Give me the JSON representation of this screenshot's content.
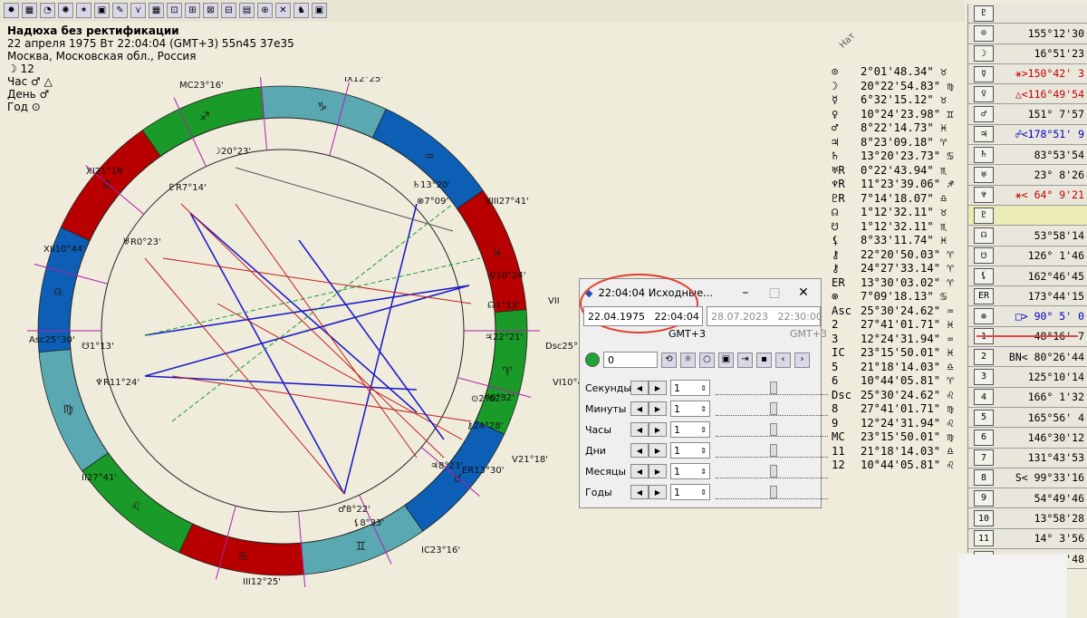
{
  "header": {
    "title": "Надюха без ректификации",
    "date_line": "22 апреля 1975  Вт  22:04:04 (GMT+3) 55n45  37e35",
    "place": "Москва, Московская обл., Россия",
    "moon_line": "☽  12",
    "hour_line": "Час ♂ △",
    "day_line": "День ♂",
    "year_line": "Год ⊙"
  },
  "toolbar": {
    "icons": [
      "✹",
      "▦",
      "◔",
      "✺",
      "✶",
      "▣",
      "✎",
      "⋎",
      "▦",
      "⊡",
      "⊞",
      "⊠",
      "⊟",
      "▤",
      "⊕",
      "✕",
      "♞",
      "▣"
    ]
  },
  "chart": {
    "house_labels": [
      "MC23°16'",
      "IX12°25'",
      "VIII27°41'",
      "VII",
      "Dsc25°30'",
      "VI10°44'",
      "V21°18'",
      "IC23°16'",
      "III12°25'",
      "II27°41'",
      "Asc25°30'",
      "XII10°44'",
      "XI21°18'"
    ],
    "planet_marks": [
      "☽20°23'",
      "♇R7°14'",
      "♄13°20'",
      "⊗7°09'",
      "♀10°24'",
      "☊1°13'",
      "♃22°21'",
      "⊙2°02'",
      "☿6°32'",
      "⚷24°28'",
      "♃8°23'",
      "ER13°30'",
      "♂8°22'",
      "⚸8°33'",
      "♅R0°23'",
      "☋1°13'",
      "♆R11°24'"
    ],
    "signs": [
      "♍",
      "♌",
      "♋",
      "♊",
      "♉",
      "♈",
      "♓",
      "♒",
      "♑",
      "♐",
      "♏",
      "♎"
    ]
  },
  "positions": {
    "heading": "Нат",
    "rows": [
      [
        "⊙",
        "2°01'48.34\" ♉"
      ],
      [
        "☽",
        "20°22'54.83\" ♍"
      ],
      [
        "☿",
        "6°32'15.12\" ♉"
      ],
      [
        "♀",
        "10°24'23.98\" ♊"
      ],
      [
        "♂",
        "8°22'14.73\" ♓"
      ],
      [
        "♃",
        "8°23'09.18\" ♈"
      ],
      [
        "♄",
        "13°20'23.73\" ♋"
      ],
      [
        "♅R",
        "0°22'43.94\" ♏"
      ],
      [
        "♆R",
        "11°23'39.06\" ♐"
      ],
      [
        "♇R",
        "7°14'18.07\" ♎"
      ],
      [
        "☊",
        "1°12'32.11\" ♉"
      ],
      [
        "☋",
        "1°12'32.11\" ♏"
      ],
      [
        "⚸",
        "8°33'11.74\" ♓"
      ],
      [
        "⚷",
        "22°20'50.03\" ♈"
      ],
      [
        "⚷",
        "24°27'33.14\" ♈"
      ],
      [
        "ER",
        "13°30'03.02\" ♈"
      ],
      [
        "⊗",
        "7°09'18.13\" ♋"
      ],
      [
        "Asc",
        "25°30'24.62\" ♒"
      ],
      [
        "2",
        "27°41'01.71\" ♓"
      ],
      [
        "3",
        "12°24'31.94\" ♒"
      ],
      [
        "IC",
        "23°15'50.01\" ♓"
      ],
      [
        "5",
        "21°18'14.03\" ♎"
      ],
      [
        "6",
        "10°44'05.81\" ♈"
      ],
      [
        "Dsc",
        "25°30'24.62\" ♌"
      ],
      [
        "8",
        "27°41'01.71\" ♍"
      ],
      [
        "9",
        "12°24'31.94\" ♌"
      ],
      [
        "MC",
        "23°15'50.01\" ♍"
      ],
      [
        "11",
        "21°18'14.03\" ♎"
      ],
      [
        "12",
        "10°44'05.81\" ♌"
      ]
    ]
  },
  "aspects": {
    "heading": "♇",
    "rows": [
      {
        "sym": "⊙",
        "val": "155°12'30",
        "tone": ""
      },
      {
        "sym": "☽",
        "val": "16°51'23",
        "tone": ""
      },
      {
        "sym": "☿",
        "val": "⚹>150°42' 3",
        "tone": "red"
      },
      {
        "sym": "♀",
        "val": "△<116°49'54",
        "tone": "red"
      },
      {
        "sym": "♂",
        "val": "151° 7'57",
        "tone": ""
      },
      {
        "sym": "♃",
        "val": "☍<178°51' 9",
        "tone": "blue"
      },
      {
        "sym": "♄",
        "val": "83°53'54",
        "tone": ""
      },
      {
        "sym": "♅",
        "val": "23° 8'26",
        "tone": ""
      },
      {
        "sym": "♆",
        "val": "⚹< 64° 9'21",
        "tone": "red"
      },
      {
        "sym": "♇",
        "val": "",
        "tone": "hl"
      },
      {
        "sym": "☊",
        "val": "53°58'14",
        "tone": ""
      },
      {
        "sym": "☋",
        "val": "126° 1'46",
        "tone": ""
      },
      {
        "sym": "⚸",
        "val": "162°46'45",
        "tone": ""
      },
      {
        "sym": "ER",
        "val": "173°44'15",
        "tone": ""
      },
      {
        "sym": "⊗",
        "val": "□> 90° 5' 0",
        "tone": "blue"
      },
      {
        "sym": "1",
        "val": "48°16' 7",
        "tone": ""
      },
      {
        "sym": "2",
        "val": "BN< 80°26'44",
        "tone": ""
      },
      {
        "sym": "3",
        "val": "125°10'14",
        "tone": ""
      },
      {
        "sym": "4",
        "val": "166° 1'32",
        "tone": ""
      },
      {
        "sym": "5",
        "val": "165°56' 4",
        "tone": ""
      },
      {
        "sym": "6",
        "val": "146°30'12",
        "tone": ""
      },
      {
        "sym": "7",
        "val": "131°43'53",
        "tone": ""
      },
      {
        "sym": "8",
        "val": "S< 99°33'16",
        "tone": ""
      },
      {
        "sym": "9",
        "val": "54°49'46",
        "tone": ""
      },
      {
        "sym": "10",
        "val": "13°58'28",
        "tone": ""
      },
      {
        "sym": "11",
        "val": "14° 3'56",
        "tone": ""
      },
      {
        "sym": "12",
        "val": "33°29'48",
        "tone": ""
      }
    ]
  },
  "dialog": {
    "title": "22:04:04 Исходные...",
    "date1": "22.04.1975",
    "time1": "22:04:04",
    "tz": "GMT+3",
    "date2": "28.07.2023",
    "time2": "22:30:00",
    "tz2": "GMT+3",
    "counter": "0",
    "steps": [
      {
        "label": "Секунды",
        "value": "1"
      },
      {
        "label": "Минуты",
        "value": "1"
      },
      {
        "label": "Часы",
        "value": "1"
      },
      {
        "label": "Дни",
        "value": "1"
      },
      {
        "label": "Месяцы",
        "value": "1"
      },
      {
        "label": "Годы",
        "value": "1"
      }
    ]
  },
  "colors": {
    "fire": "#b80000",
    "earth": "#1a9a28",
    "air": "#5aa9b2",
    "water": "#0d5fb5",
    "highlight": "#e0402e"
  }
}
